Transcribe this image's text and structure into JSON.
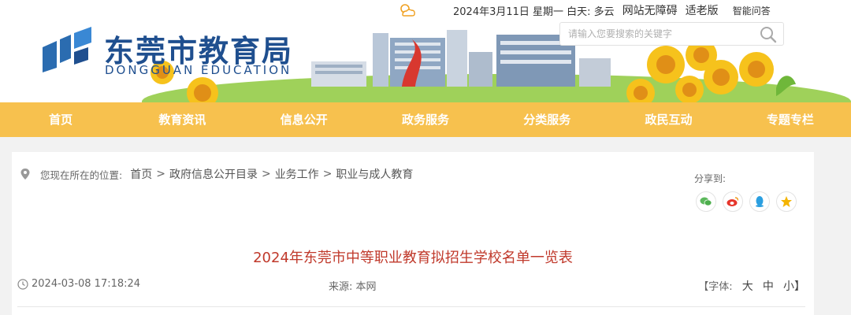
{
  "site": {
    "title": "东莞市教育局",
    "subtitle": "DONGGUAN EDUCATION"
  },
  "topbar": {
    "date": "2024年3月11日 星期一 白天: 多云",
    "accessible": "网站无障碍",
    "elderly": "适老版",
    "qa": "智能问答"
  },
  "search": {
    "placeholder": "请输入您要搜索的关键字"
  },
  "nav": {
    "items": [
      {
        "label": "首页"
      },
      {
        "label": "教育资讯"
      },
      {
        "label": "信息公开"
      },
      {
        "label": "政务服务"
      },
      {
        "label": "分类服务"
      },
      {
        "label": "政民互动"
      },
      {
        "label": "专题专栏"
      }
    ]
  },
  "breadcrumb": {
    "label": "您现在所在的位置:",
    "items": [
      "首页",
      "政府信息公开目录",
      "业务工作",
      "职业与成人教育"
    ],
    "sep": ">"
  },
  "share": {
    "label": "分享到:",
    "icons": [
      "wechat-icon",
      "weibo-icon",
      "qq-icon",
      "qzone-icon"
    ]
  },
  "article": {
    "title": "2024年东莞市中等职业教育拟招生学校名单一览表",
    "time": "2024-03-08 17:18:24",
    "source": "来源: 本网",
    "font_label": "【字体:",
    "font_large": "大",
    "font_medium": "中",
    "font_small": "小】"
  },
  "colors": {
    "nav_bg": "#f7c14e",
    "brand_blue": "#1f4f8f",
    "title_red": "#c0392b",
    "grass": "#9fd15a"
  }
}
